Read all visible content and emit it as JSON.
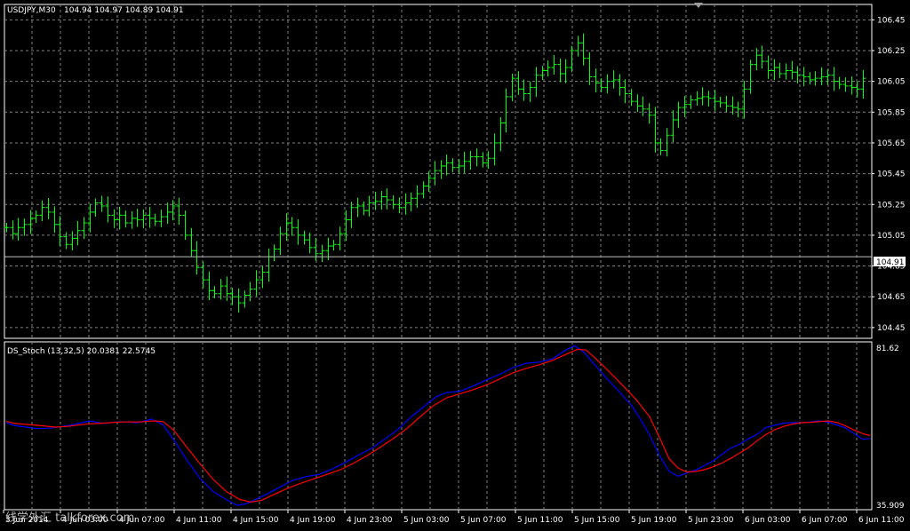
{
  "window": {
    "symbol_label": "USDJPY,M30",
    "ohlc_text": "104.94 104.97 104.89 104.91",
    "indicator_label": "DS_Stoch (13,32,5) 20.0381 22.5745",
    "current_price_label": "104.91",
    "watermark": "线学外汇 talkforex.com"
  },
  "colors": {
    "background": "#000000",
    "grid": "#7f7f7f",
    "bars": "#00ff00",
    "stoch_main": "#0000ff",
    "stoch_signal": "#ff0000",
    "text": "#ffffff"
  },
  "chart_data": [
    {
      "type": "ohlc",
      "title": "USDJPY,M30",
      "ylim": [
        104.38,
        106.55
      ],
      "y_ticks": [
        "106.45",
        "106.25",
        "106.05",
        "105.85",
        "105.65",
        "105.45",
        "105.25",
        "105.05",
        "104.85",
        "104.65",
        "104.45"
      ],
      "current_price": 104.91,
      "grid": true,
      "closes": [
        105.1,
        105.06,
        105.1,
        105.12,
        105.16,
        105.18,
        105.23,
        105.2,
        105.12,
        105.04,
        104.99,
        105.03,
        105.08,
        105.13,
        105.2,
        105.26,
        105.24,
        105.18,
        105.15,
        105.18,
        105.13,
        105.16,
        105.15,
        105.18,
        105.16,
        105.14,
        105.17,
        105.2,
        105.24,
        105.18,
        105.05,
        104.95,
        104.84,
        104.76,
        104.69,
        104.67,
        104.72,
        104.67,
        104.65,
        104.61,
        104.66,
        104.7,
        104.76,
        104.81,
        104.91,
        104.96,
        105.06,
        105.13,
        105.1,
        105.05,
        105.02,
        104.97,
        104.93,
        104.95,
        104.98,
        104.99,
        105.06,
        105.15,
        105.23,
        105.24,
        105.21,
        105.26,
        105.27,
        105.3,
        105.28,
        105.25,
        105.23,
        105.26,
        105.29,
        105.32,
        105.37,
        105.42,
        105.47,
        105.5,
        105.52,
        105.49,
        105.5,
        105.53,
        105.56,
        105.56,
        105.52,
        105.55,
        105.65,
        105.78,
        105.95,
        106.07,
        106.0,
        105.97,
        106.01,
        106.09,
        106.12,
        106.14,
        106.16,
        106.1,
        106.14,
        106.25,
        106.3,
        106.2,
        106.08,
        106.04,
        106.01,
        106.05,
        106.06,
        106.01,
        105.97,
        105.92,
        105.89,
        105.87,
        105.83,
        105.65,
        105.6,
        105.7,
        105.8,
        105.88,
        105.9,
        105.93,
        105.94,
        105.95,
        105.94,
        105.92,
        105.91,
        105.89,
        105.88,
        105.87,
        106.0,
        106.16,
        106.22,
        106.18,
        106.12,
        106.14,
        106.1,
        106.12,
        106.11,
        106.09,
        106.08,
        106.06,
        106.07,
        106.08,
        106.09,
        106.05,
        106.03,
        106.02,
        106.01,
        106.0,
        106.07
      ]
    },
    {
      "type": "line",
      "title": "DS_Stoch (13,32,5)",
      "ylim": [
        35.909,
        81.62
      ],
      "y_ticks": [
        "81.62",
        "35.909"
      ],
      "x_tick_labels": [
        "3 Jun 2014",
        "4 Jun 03:00",
        "4 Jun 07:00",
        "4 Jun 11:00",
        "4 Jun 15:00",
        "4 Jun 19:00",
        "4 Jun 23:00",
        "5 Jun 03:00",
        "5 Jun 07:00",
        "5 Jun 11:00",
        "5 Jun 15:00",
        "5 Jun 19:00",
        "5 Jun 23:00",
        "6 Jun 03:00",
        "6 Jun 07:00",
        "6 Jun 11:00"
      ],
      "grid": true,
      "series": [
        {
          "color": "#0000ff",
          "values": [
            {
              "x": 0,
              "y": 59.6
            },
            {
              "x": 10,
              "y": 58.8
            },
            {
              "x": 20,
              "y": 58.5
            },
            {
              "x": 35,
              "y": 58.0
            },
            {
              "x": 50,
              "y": 58.1
            },
            {
              "x": 70,
              "y": 58.8
            },
            {
              "x": 80,
              "y": 59.3
            },
            {
              "x": 95,
              "y": 60.1
            },
            {
              "x": 110,
              "y": 59.4
            },
            {
              "x": 130,
              "y": 59.9
            },
            {
              "x": 150,
              "y": 59.6
            },
            {
              "x": 165,
              "y": 60.6
            },
            {
              "x": 178,
              "y": 59.0
            },
            {
              "x": 190,
              "y": 55.0
            },
            {
              "x": 205,
              "y": 49.4
            },
            {
              "x": 220,
              "y": 44.4
            },
            {
              "x": 235,
              "y": 40.8
            },
            {
              "x": 250,
              "y": 38.6
            },
            {
              "x": 262,
              "y": 37.1
            },
            {
              "x": 272,
              "y": 37.5
            },
            {
              "x": 282,
              "y": 38.6
            },
            {
              "x": 295,
              "y": 40.1
            },
            {
              "x": 310,
              "y": 42.0
            },
            {
              "x": 325,
              "y": 43.9
            },
            {
              "x": 340,
              "y": 44.9
            },
            {
              "x": 355,
              "y": 45.5
            },
            {
              "x": 370,
              "y": 47.0
            },
            {
              "x": 385,
              "y": 48.8
            },
            {
              "x": 400,
              "y": 50.8
            },
            {
              "x": 415,
              "y": 52.7
            },
            {
              "x": 430,
              "y": 55.2
            },
            {
              "x": 445,
              "y": 57.9
            },
            {
              "x": 460,
              "y": 61.3
            },
            {
              "x": 475,
              "y": 64.2
            },
            {
              "x": 488,
              "y": 66.7
            },
            {
              "x": 500,
              "y": 67.8
            },
            {
              "x": 515,
              "y": 68.2
            },
            {
              "x": 530,
              "y": 69.6
            },
            {
              "x": 545,
              "y": 71.3
            },
            {
              "x": 560,
              "y": 72.8
            },
            {
              "x": 575,
              "y": 74.6
            },
            {
              "x": 590,
              "y": 75.8
            },
            {
              "x": 605,
              "y": 76.1
            },
            {
              "x": 620,
              "y": 77.0
            },
            {
              "x": 635,
              "y": 79.4
            },
            {
              "x": 645,
              "y": 80.6
            },
            {
              "x": 655,
              "y": 78.9
            },
            {
              "x": 668,
              "y": 75.3
            },
            {
              "x": 680,
              "y": 72.0
            },
            {
              "x": 695,
              "y": 68.2
            },
            {
              "x": 710,
              "y": 64.1
            },
            {
              "x": 720,
              "y": 60.4
            },
            {
              "x": 730,
              "y": 56.2
            },
            {
              "x": 742,
              "y": 50.3
            },
            {
              "x": 752,
              "y": 46.4
            },
            {
              "x": 762,
              "y": 45.0
            },
            {
              "x": 772,
              "y": 45.9
            },
            {
              "x": 782,
              "y": 46.7
            },
            {
              "x": 792,
              "y": 47.9
            },
            {
              "x": 802,
              "y": 49.2
            },
            {
              "x": 812,
              "y": 51.0
            },
            {
              "x": 822,
              "y": 52.7
            },
            {
              "x": 832,
              "y": 53.7
            },
            {
              "x": 842,
              "y": 55.2
            },
            {
              "x": 852,
              "y": 56.4
            },
            {
              "x": 862,
              "y": 58.3
            },
            {
              "x": 872,
              "y": 58.9
            },
            {
              "x": 882,
              "y": 59.5
            },
            {
              "x": 892,
              "y": 59.6
            },
            {
              "x": 902,
              "y": 59.6
            },
            {
              "x": 912,
              "y": 59.8
            },
            {
              "x": 922,
              "y": 60.1
            },
            {
              "x": 932,
              "y": 59.8
            },
            {
              "x": 942,
              "y": 59.0
            },
            {
              "x": 952,
              "y": 58.2
            },
            {
              "x": 962,
              "y": 56.6
            },
            {
              "x": 972,
              "y": 55.1
            },
            {
              "x": 980,
              "y": 55.3
            }
          ]
        },
        {
          "color": "#ff0000",
          "values": [
            {
              "x": 0,
              "y": 60.0
            },
            {
              "x": 10,
              "y": 59.4
            },
            {
              "x": 25,
              "y": 59.1
            },
            {
              "x": 40,
              "y": 58.8
            },
            {
              "x": 55,
              "y": 58.4
            },
            {
              "x": 70,
              "y": 58.6
            },
            {
              "x": 90,
              "y": 59.2
            },
            {
              "x": 110,
              "y": 59.5
            },
            {
              "x": 130,
              "y": 59.8
            },
            {
              "x": 150,
              "y": 59.8
            },
            {
              "x": 168,
              "y": 60.1
            },
            {
              "x": 178,
              "y": 59.9
            },
            {
              "x": 190,
              "y": 57.6
            },
            {
              "x": 205,
              "y": 52.9
            },
            {
              "x": 220,
              "y": 48.4
            },
            {
              "x": 235,
              "y": 44.1
            },
            {
              "x": 250,
              "y": 40.8
            },
            {
              "x": 265,
              "y": 38.7
            },
            {
              "x": 278,
              "y": 38.0
            },
            {
              "x": 290,
              "y": 38.5
            },
            {
              "x": 305,
              "y": 40.2
            },
            {
              "x": 320,
              "y": 41.8
            },
            {
              "x": 335,
              "y": 43.2
            },
            {
              "x": 350,
              "y": 44.4
            },
            {
              "x": 365,
              "y": 45.6
            },
            {
              "x": 380,
              "y": 46.9
            },
            {
              "x": 395,
              "y": 48.7
            },
            {
              "x": 410,
              "y": 50.7
            },
            {
              "x": 425,
              "y": 53.0
            },
            {
              "x": 440,
              "y": 55.4
            },
            {
              "x": 455,
              "y": 58.1
            },
            {
              "x": 470,
              "y": 61.3
            },
            {
              "x": 485,
              "y": 64.3
            },
            {
              "x": 500,
              "y": 66.4
            },
            {
              "x": 515,
              "y": 67.5
            },
            {
              "x": 530,
              "y": 68.6
            },
            {
              "x": 545,
              "y": 69.9
            },
            {
              "x": 560,
              "y": 71.5
            },
            {
              "x": 575,
              "y": 73.2
            },
            {
              "x": 590,
              "y": 74.4
            },
            {
              "x": 605,
              "y": 75.4
            },
            {
              "x": 620,
              "y": 76.6
            },
            {
              "x": 635,
              "y": 78.2
            },
            {
              "x": 648,
              "y": 79.6
            },
            {
              "x": 658,
              "y": 79.4
            },
            {
              "x": 670,
              "y": 76.8
            },
            {
              "x": 685,
              "y": 73.3
            },
            {
              "x": 700,
              "y": 69.6
            },
            {
              "x": 715,
              "y": 65.8
            },
            {
              "x": 730,
              "y": 61.2
            },
            {
              "x": 742,
              "y": 55.2
            },
            {
              "x": 752,
              "y": 49.8
            },
            {
              "x": 762,
              "y": 47.3
            },
            {
              "x": 772,
              "y": 46.2
            },
            {
              "x": 782,
              "y": 46.3
            },
            {
              "x": 792,
              "y": 46.8
            },
            {
              "x": 802,
              "y": 47.6
            },
            {
              "x": 812,
              "y": 48.6
            },
            {
              "x": 822,
              "y": 49.9
            },
            {
              "x": 832,
              "y": 51.3
            },
            {
              "x": 842,
              "y": 52.8
            },
            {
              "x": 852,
              "y": 54.7
            },
            {
              "x": 862,
              "y": 56.4
            },
            {
              "x": 872,
              "y": 57.7
            },
            {
              "x": 882,
              "y": 58.6
            },
            {
              "x": 892,
              "y": 59.2
            },
            {
              "x": 902,
              "y": 59.6
            },
            {
              "x": 912,
              "y": 59.7
            },
            {
              "x": 922,
              "y": 59.9
            },
            {
              "x": 932,
              "y": 60.1
            },
            {
              "x": 942,
              "y": 59.7
            },
            {
              "x": 952,
              "y": 58.8
            },
            {
              "x": 962,
              "y": 57.6
            },
            {
              "x": 972,
              "y": 56.6
            },
            {
              "x": 980,
              "y": 56.1
            }
          ]
        }
      ]
    }
  ]
}
